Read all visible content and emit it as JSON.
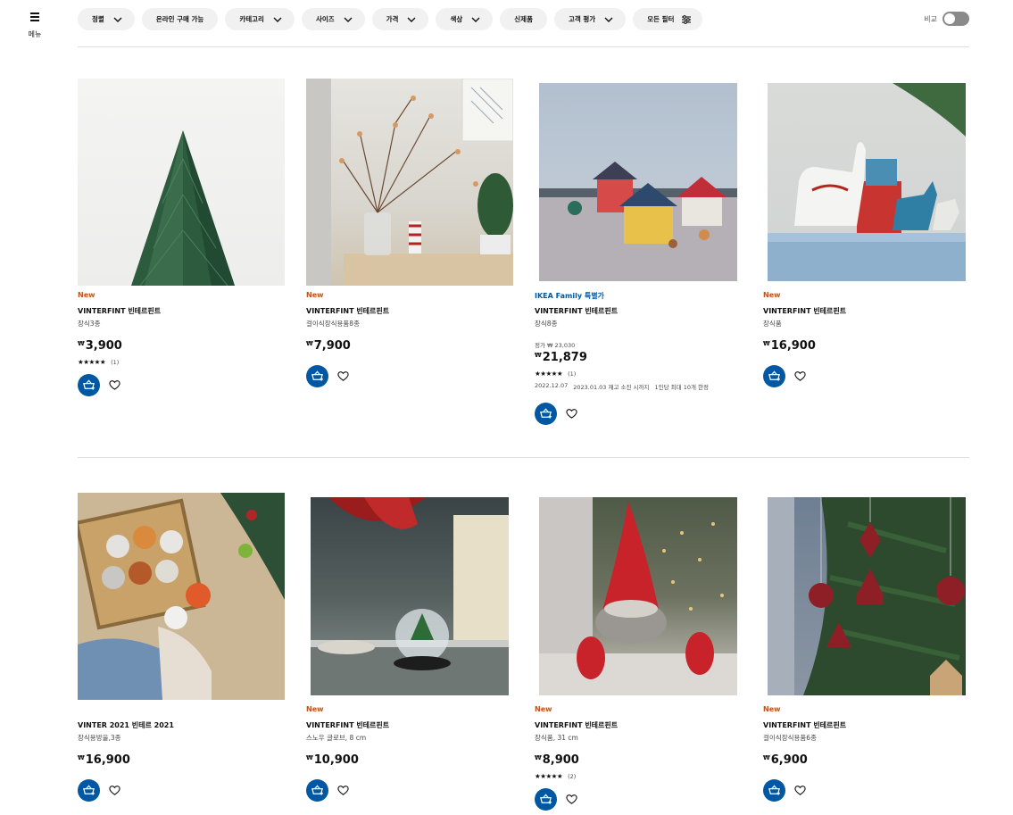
{
  "menu": {
    "label": "메뉴",
    "icon": "hamburger-icon"
  },
  "filters": [
    {
      "label": "정렬",
      "icon": "chevron-down-icon"
    },
    {
      "label": "온라인 구매 가능",
      "icon": ""
    },
    {
      "label": "카테고리",
      "icon": "chevron-down-icon"
    },
    {
      "label": "사이즈",
      "icon": "chevron-down-icon"
    },
    {
      "label": "가격",
      "icon": "chevron-down-icon"
    },
    {
      "label": "색상",
      "icon": "chevron-down-icon"
    },
    {
      "label": "신제품",
      "icon": ""
    },
    {
      "label": "고객 평가",
      "icon": "chevron-down-icon"
    },
    {
      "label": "모든 필터",
      "icon": "sliders-icon"
    }
  ],
  "compare": {
    "label": "비교",
    "enabled": false
  },
  "colors": {
    "accent": "#0058a3",
    "new_badge": "#c4501e",
    "family_badge": "#0058a3"
  },
  "products": [
    {
      "badge": "New",
      "name": "VINTERFINT 빈테르핀트",
      "desc": "장식3종",
      "currency": "₩",
      "price": "3,900",
      "stars": "★★★★★",
      "rating_count": "(1)"
    },
    {
      "badge": "New",
      "name": "VINTERFINT 빈테르핀트",
      "desc": "걸이식장식용품8종",
      "currency": "₩",
      "price": "7,900"
    },
    {
      "badge": "IKEA Family 특별가",
      "name": "VINTERFINT 빈테르핀트",
      "desc": "장식8종",
      "old_price": "정가 ₩ 23,030",
      "currency": "₩",
      "price": "21,879",
      "stars": "★★★★★",
      "rating_count": "(1)",
      "date_start": "2022.12.07",
      "date_end": "2023.01.03 재고 소진 시까지",
      "limit": "1인당 최대 10개 한정"
    },
    {
      "badge": "New",
      "name": "VINTERFINT 빈테르핀트",
      "desc": "장식품",
      "currency": "₩",
      "price": "16,900"
    },
    {
      "badge": "",
      "name": "VINTER 2021 빈테르 2021",
      "desc": "장식용방울,3종",
      "currency": "₩",
      "price": "16,900"
    },
    {
      "badge": "New",
      "name": "VINTERFINT 빈테르핀트",
      "desc": "스노우 글로브, 8 cm",
      "currency": "₩",
      "price": "10,900"
    },
    {
      "badge": "New",
      "name": "VINTERFINT 빈테르핀트",
      "desc": "장식품, 31 cm",
      "currency": "₩",
      "price": "8,900",
      "stars": "★★★★★",
      "rating_count": "(2)"
    },
    {
      "badge": "New",
      "name": "VINTERFINT 빈테르핀트",
      "desc": "걸이식장식용품6종",
      "currency": "₩",
      "price": "6,900"
    }
  ]
}
